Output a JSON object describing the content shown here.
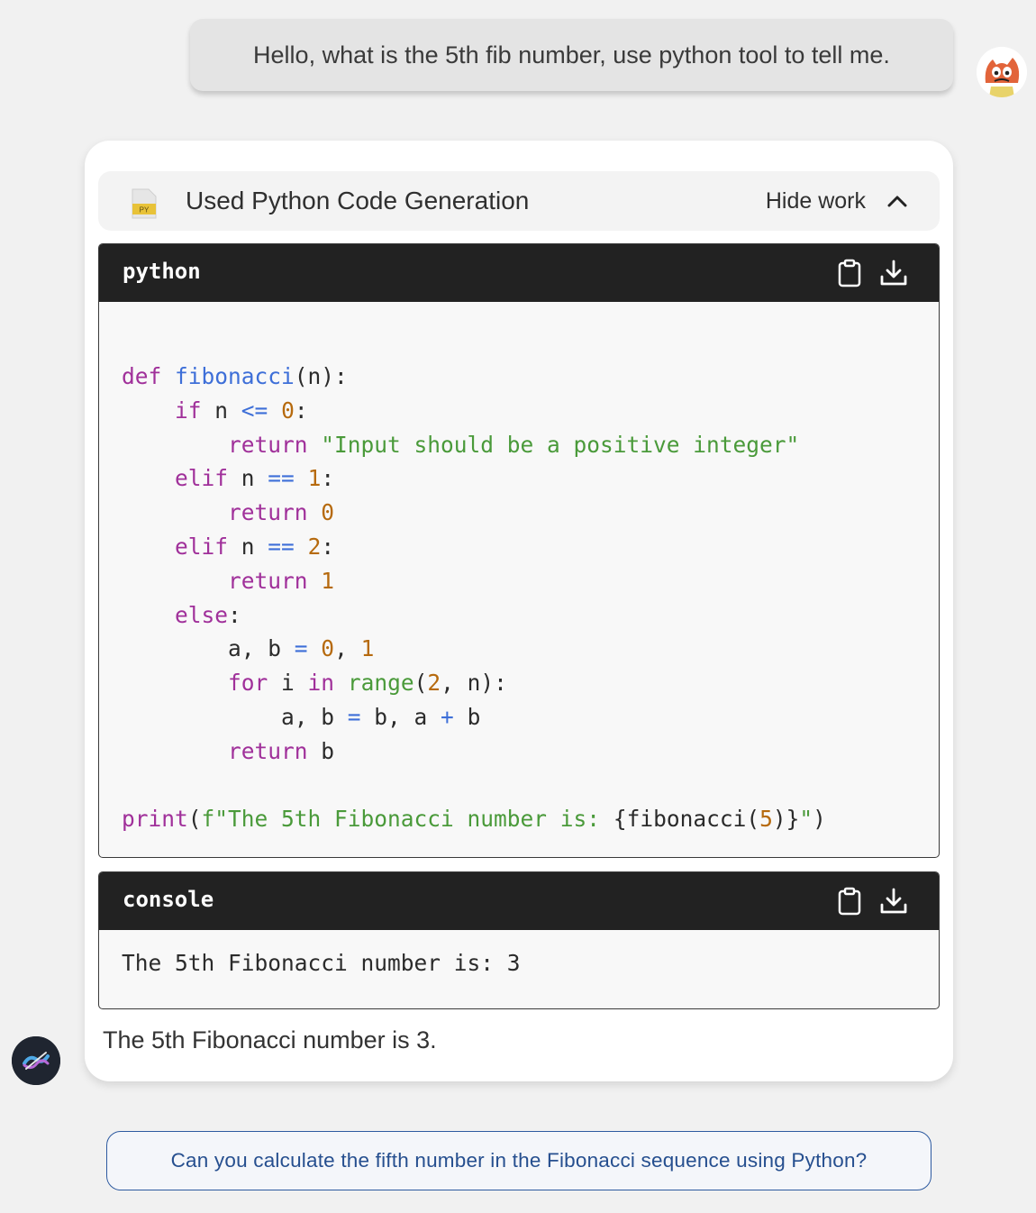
{
  "user_message": "Hello, what is the 5th fib number, use python tool to tell me.",
  "tool": {
    "file_icon_label": "PY",
    "title": "Used Python Code Generation",
    "toggle_label": "Hide work"
  },
  "code_block": {
    "language": "python",
    "lines": [
      "def fibonacci(n):",
      "    if n <= 0:",
      "        return \"Input should be a positive integer\"",
      "    elif n == 1:",
      "        return 0",
      "    elif n == 2:",
      "        return 1",
      "    else:",
      "        a, b = 0, 1",
      "        for i in range(2, n):",
      "            a, b = b, a + b",
      "        return b",
      "",
      "print(f\"The 5th Fibonacci number is: {fibonacci(5)}\")"
    ]
  },
  "console_block": {
    "label": "console",
    "output": "The 5th Fibonacci number is: 3"
  },
  "answer": "The 5th Fibonacci number is 3.",
  "suggestion": "Can you calculate the fifth number in the Fibonacci sequence using Python?",
  "colors": {
    "keyword": "#a0309a",
    "function": "#3e6fd8",
    "number": "#b66a0e",
    "string": "#4a9a3a",
    "suggestion_border": "#2d5aa0"
  }
}
